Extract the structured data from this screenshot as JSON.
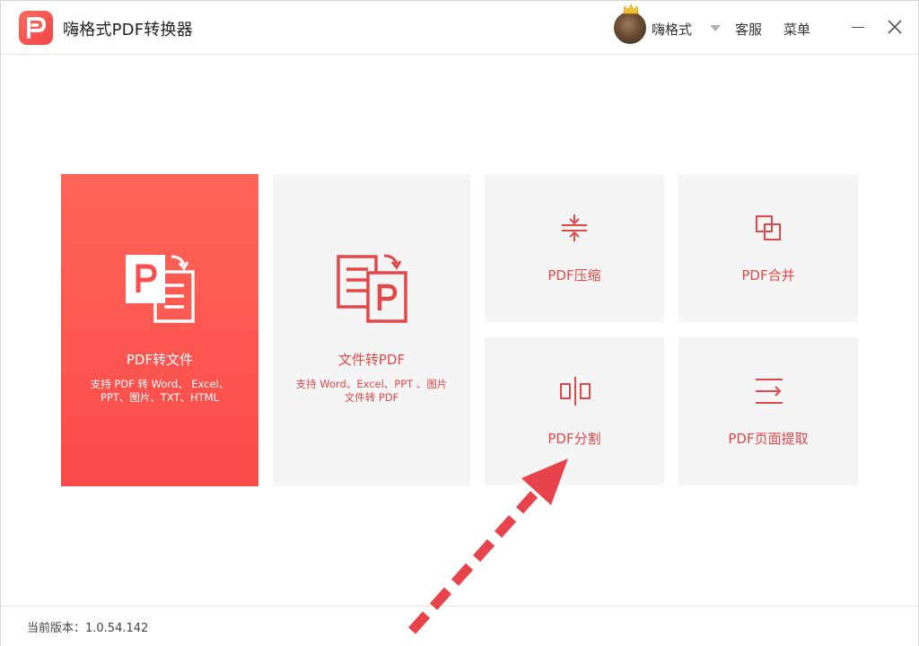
{
  "app": {
    "title": "嗨格式PDF转换器",
    "accent_color": "#f45050"
  },
  "header": {
    "username": "嗨格式",
    "support_label": "客服",
    "menu_label": "菜单",
    "icons": [
      "app-logo-icon",
      "crown-icon",
      "dropdown-caret-icon",
      "minimize-icon",
      "close-icon"
    ]
  },
  "tiles": {
    "pdf_to_file": {
      "title": "PDF转文件",
      "desc": "支持 PDF 转 Word、 Excel、 PPT、图片、TXT、HTML",
      "icon": "pdf-to-document-icon"
    },
    "file_to_pdf": {
      "title": "文件转PDF",
      "desc": "支持 Word、Excel、PPT 、图片文件转 PDF",
      "icon": "document-to-pdf-icon"
    },
    "compress": {
      "title": "PDF压缩",
      "icon": "compress-icon"
    },
    "merge": {
      "title": "PDF合并",
      "icon": "merge-icon"
    },
    "split": {
      "title": "PDF分割",
      "icon": "split-icon"
    },
    "extract": {
      "title": "PDF页面提取",
      "icon": "extract-page-icon"
    }
  },
  "footer": {
    "version_label": "当前版本：1.0.54.142"
  },
  "annotation": {
    "arrow_color": "#e8434a",
    "arrow_style": "dashed"
  }
}
